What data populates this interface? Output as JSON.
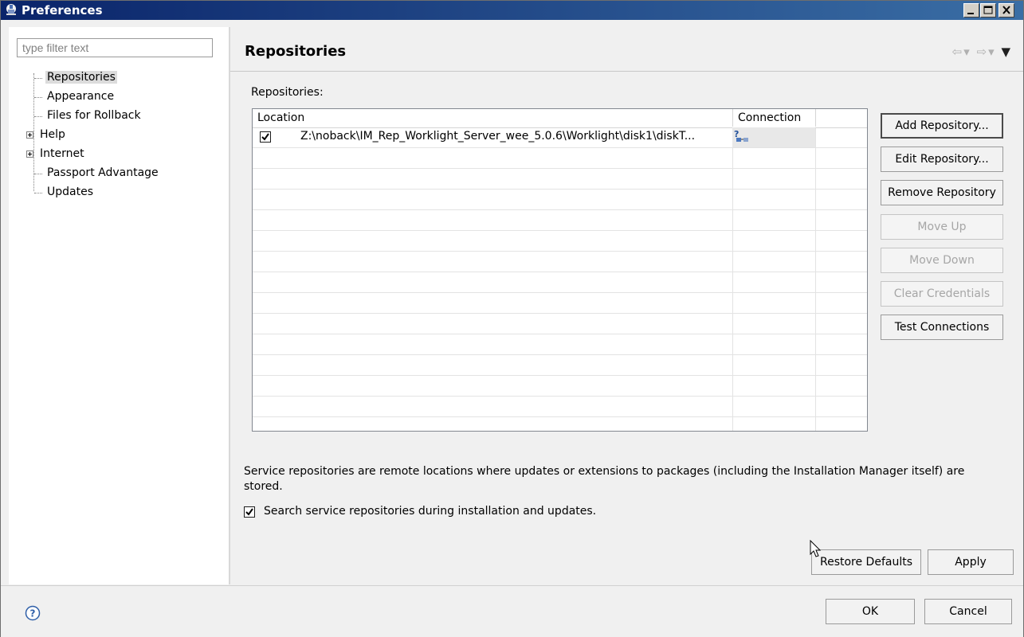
{
  "window": {
    "title": "Preferences"
  },
  "filter": {
    "placeholder": "type filter text"
  },
  "tree": {
    "items": [
      {
        "label": "Repositories",
        "selected": true,
        "expandable": false
      },
      {
        "label": "Appearance",
        "selected": false,
        "expandable": false
      },
      {
        "label": "Files for Rollback",
        "selected": false,
        "expandable": false
      },
      {
        "label": "Help",
        "selected": false,
        "expandable": true
      },
      {
        "label": "Internet",
        "selected": false,
        "expandable": true
      },
      {
        "label": "Passport Advantage",
        "selected": false,
        "expandable": false
      },
      {
        "label": "Updates",
        "selected": false,
        "expandable": false
      }
    ]
  },
  "page": {
    "title": "Repositories",
    "sublabel": "Repositories:"
  },
  "table": {
    "columns": [
      "Location",
      "Connection",
      ""
    ],
    "rows": [
      {
        "checked": true,
        "location": "Z:\\noback\\IM_Rep_Worklight_Server_wee_5.0.6\\Worklight\\disk1\\diskT...",
        "connection_icon": "connection-unknown-icon"
      }
    ]
  },
  "side_buttons": {
    "add": "Add Repository...",
    "edit": "Edit Repository...",
    "remove": "Remove Repository",
    "move_up": "Move Up",
    "move_down": "Move Down",
    "clear_credentials": "Clear Credentials",
    "test_connections": "Test Connections"
  },
  "description": "Service repositories are remote locations where updates or extensions to packages (including the Installation Manager itself) are stored.",
  "search_checkbox": {
    "label": "Search service repositories during installation and updates.",
    "checked": true
  },
  "page_buttons": {
    "restore_defaults": "Restore Defaults",
    "apply": "Apply"
  },
  "dialog_buttons": {
    "ok": "OK",
    "cancel": "Cancel"
  },
  "colors": {
    "titlebar_start": "#0a246a",
    "titlebar_end": "#3a6ea5",
    "selection": "#dcdcdc",
    "disabled_text": "#a6a6a6"
  }
}
